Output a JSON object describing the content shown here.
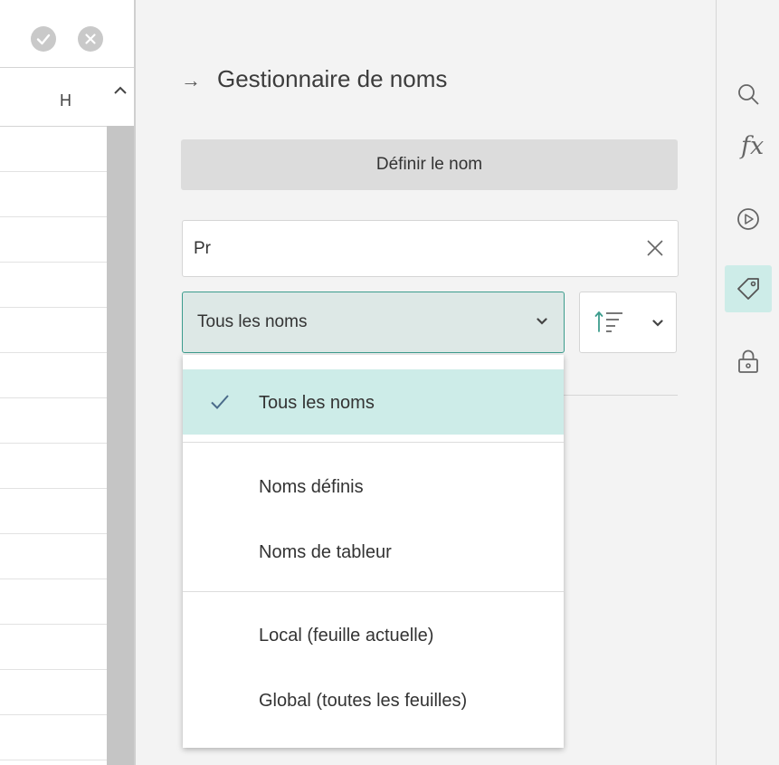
{
  "sheet": {
    "confirm_icon": "check-circle-icon",
    "cancel_icon": "x-circle-icon",
    "column_header": "H"
  },
  "panel": {
    "title": "Gestionnaire de noms",
    "back_icon": "arrow-right-icon",
    "define_button": "Définir le nom",
    "search_value": "Pr",
    "clear_icon": "close-icon",
    "filter_selected": "Tous les noms",
    "sort_icon": "sort-ascending-icon"
  },
  "dropdown": {
    "items": [
      {
        "label": "Tous les noms",
        "selected": true
      },
      {
        "label": "Noms définis",
        "selected": false
      },
      {
        "label": "Noms de tableur",
        "selected": false
      },
      {
        "label": "Local (feuille actuelle)",
        "selected": false
      },
      {
        "label": "Global (toutes les feuilles)",
        "selected": false
      }
    ]
  },
  "rail": {
    "items": [
      "search-icon",
      "fx-icon",
      "play-icon",
      "tag-icon",
      "lock-icon"
    ],
    "fx_label": "fx",
    "active": "tag-icon"
  },
  "colors": {
    "accent": "#3c9c8d",
    "accent_light": "#cdece8",
    "panel_bg": "#f3f3f3",
    "button_bg": "#dcdcdc"
  }
}
